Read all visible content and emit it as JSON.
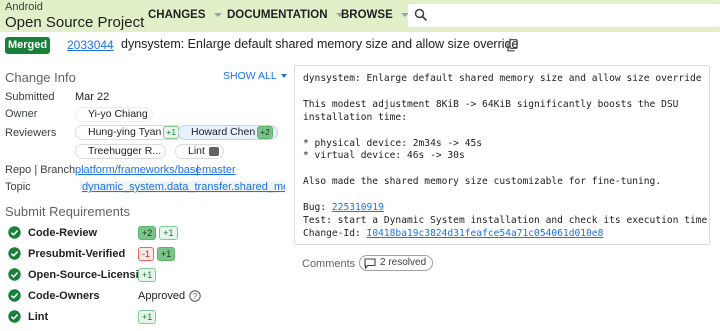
{
  "brand": {
    "small": "Android",
    "big": "Open Source Project"
  },
  "nav": [
    {
      "label": "CHANGES"
    },
    {
      "label": "DOCUMENTATION"
    },
    {
      "label": "BROWSE"
    }
  ],
  "search": {
    "placeholder": ""
  },
  "change": {
    "status": "Merged",
    "number": "2033044",
    "subject": "dynsystem: Enlarge default shared memory size and allow size override"
  },
  "info": {
    "title": "Change Info",
    "show_all": "SHOW ALL",
    "submitted_label": "Submitted",
    "submitted": "Mar 22",
    "owner_label": "Owner",
    "owner": "Yi-yo Chiang",
    "reviewers_label": "Reviewers",
    "reviewers": [
      {
        "name": "Hung-ying Tyan",
        "vote": "+1"
      },
      {
        "name": "Howard Chen",
        "vote": "+2"
      },
      {
        "name": "Treehugger R..."
      },
      {
        "name": "Lint"
      }
    ],
    "repo_label": "Repo | Branch",
    "repo": "platform/frameworks/base",
    "branch": "master",
    "topic_label": "Topic",
    "topic": "dynamic_system.data_transfer.shared_mem..."
  },
  "requirements": {
    "title": "Submit Requirements",
    "items": [
      {
        "name": "Code-Review",
        "votes": [
          "+2",
          "+1"
        ]
      },
      {
        "name": "Presubmit-Verified",
        "votes": [
          "-1",
          "+1"
        ]
      },
      {
        "name": "Open-Source-Licensing",
        "votes": [
          "+1"
        ]
      },
      {
        "name": "Code-Owners",
        "status": "Approved"
      },
      {
        "name": "Lint",
        "votes": [
          "+1"
        ]
      }
    ]
  },
  "commit": {
    "lines": [
      "dynsystem: Enlarge default shared memory size and allow size override",
      "",
      "This modest adjustment 8KiB -> 64KiB significantly boosts the DSU",
      "installation time:",
      "",
      "* physical device: 2m34s -> 45s",
      "* virtual device: 46s -> 30s",
      "",
      "Also made the shared memory size customizable for fine-tuning.",
      ""
    ],
    "bug_label": "Bug: ",
    "bug": "225310919",
    "test_line": "Test: start a Dynamic System installation and check its execution time.",
    "changeid_label": "Change-Id: ",
    "changeid": "I0418ba19c3824d31feafce54a71c054061d010e8"
  },
  "comments": {
    "label": "Comments",
    "resolved": "2 resolved"
  },
  "colors": {
    "topbar": "#e1f0c8",
    "merged": "#188038",
    "link": "#1a73e8"
  }
}
